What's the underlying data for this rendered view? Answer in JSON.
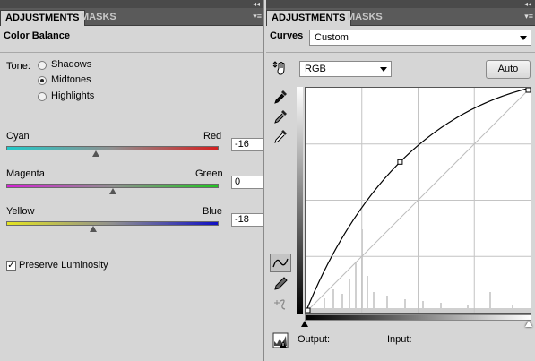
{
  "left_panel": {
    "tabs": [
      {
        "label": "ADJUSTMENTS"
      },
      {
        "label": "MASKS"
      }
    ],
    "title": "Color Balance",
    "tone": {
      "label": "Tone:",
      "options": [
        {
          "label": "Shadows",
          "selected": false
        },
        {
          "label": "Midtones",
          "selected": true
        },
        {
          "label": "Highlights",
          "selected": false
        }
      ]
    },
    "sliders": [
      {
        "left_label": "Cyan",
        "right_label": "Red",
        "value": "-16",
        "position_fraction": 0.42,
        "from_color": "#22c9c9",
        "to_color": "#d42020"
      },
      {
        "left_label": "Magenta",
        "right_label": "Green",
        "value": "0",
        "position_fraction": 0.5,
        "from_color": "#d422d4",
        "to_color": "#22c422"
      },
      {
        "left_label": "Yellow",
        "right_label": "Blue",
        "value": "-18",
        "position_fraction": 0.41,
        "from_color": "#e4e422",
        "to_color": "#1010c4"
      }
    ],
    "preserve_luminosity": {
      "label": "Preserve Luminosity",
      "checked": true
    }
  },
  "right_panel": {
    "tabs": [
      {
        "label": "ADJUSTMENTS"
      },
      {
        "label": "MASKS"
      }
    ],
    "title": "Curves",
    "preset": "Custom",
    "channel": "RGB",
    "auto_label": "Auto",
    "output_label": "Output:",
    "input_label": "Input:",
    "curve_points": [
      [
        0,
        0
      ],
      [
        0.42,
        0.67
      ],
      [
        1,
        1
      ]
    ]
  },
  "icons": {
    "on_image_tool": "hand-adjust-icon",
    "eyedroppers": [
      "black-point-eyedropper-icon",
      "gray-point-eyedropper-icon",
      "white-point-eyedropper-icon"
    ],
    "curve_tools": [
      "curve-edit-icon",
      "pencil-draw-icon",
      "smooth-curve-icon"
    ],
    "warning": "clipping-warning-icon"
  }
}
